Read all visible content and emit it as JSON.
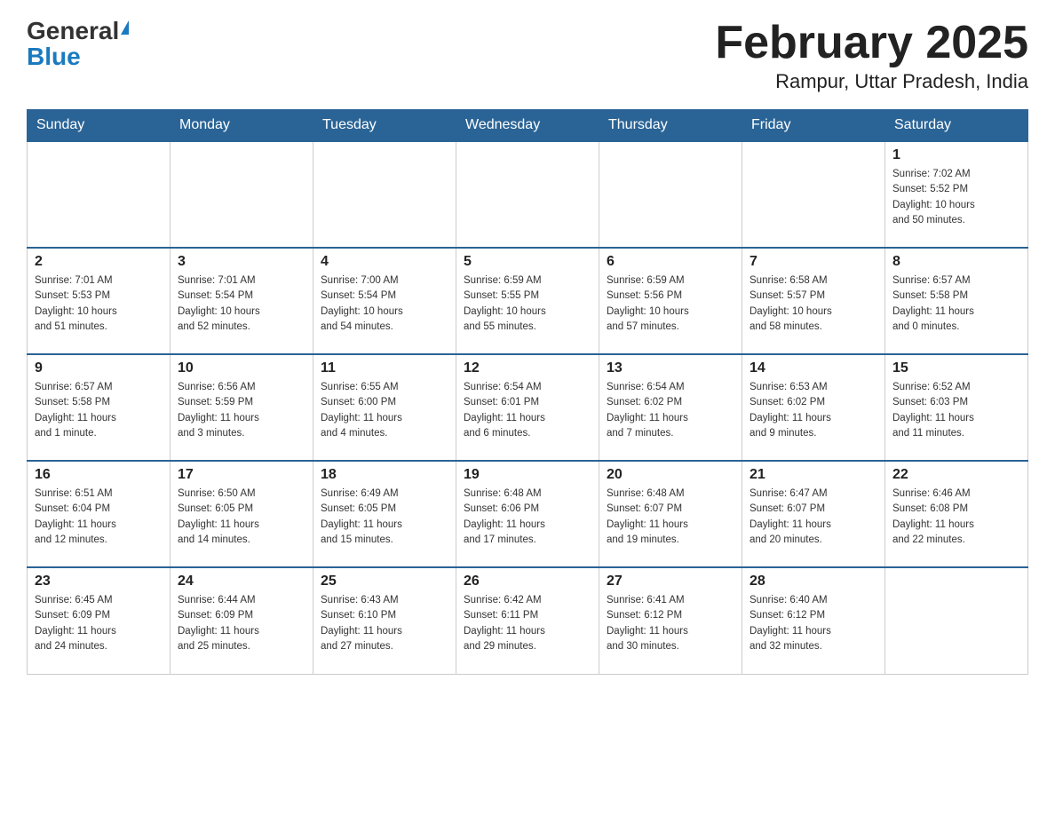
{
  "logo": {
    "general": "General",
    "blue": "Blue"
  },
  "title": "February 2025",
  "subtitle": "Rampur, Uttar Pradesh, India",
  "weekdays": [
    "Sunday",
    "Monday",
    "Tuesday",
    "Wednesday",
    "Thursday",
    "Friday",
    "Saturday"
  ],
  "weeks": [
    [
      {
        "day": "",
        "info": ""
      },
      {
        "day": "",
        "info": ""
      },
      {
        "day": "",
        "info": ""
      },
      {
        "day": "",
        "info": ""
      },
      {
        "day": "",
        "info": ""
      },
      {
        "day": "",
        "info": ""
      },
      {
        "day": "1",
        "info": "Sunrise: 7:02 AM\nSunset: 5:52 PM\nDaylight: 10 hours\nand 50 minutes."
      }
    ],
    [
      {
        "day": "2",
        "info": "Sunrise: 7:01 AM\nSunset: 5:53 PM\nDaylight: 10 hours\nand 51 minutes."
      },
      {
        "day": "3",
        "info": "Sunrise: 7:01 AM\nSunset: 5:54 PM\nDaylight: 10 hours\nand 52 minutes."
      },
      {
        "day": "4",
        "info": "Sunrise: 7:00 AM\nSunset: 5:54 PM\nDaylight: 10 hours\nand 54 minutes."
      },
      {
        "day": "5",
        "info": "Sunrise: 6:59 AM\nSunset: 5:55 PM\nDaylight: 10 hours\nand 55 minutes."
      },
      {
        "day": "6",
        "info": "Sunrise: 6:59 AM\nSunset: 5:56 PM\nDaylight: 10 hours\nand 57 minutes."
      },
      {
        "day": "7",
        "info": "Sunrise: 6:58 AM\nSunset: 5:57 PM\nDaylight: 10 hours\nand 58 minutes."
      },
      {
        "day": "8",
        "info": "Sunrise: 6:57 AM\nSunset: 5:58 PM\nDaylight: 11 hours\nand 0 minutes."
      }
    ],
    [
      {
        "day": "9",
        "info": "Sunrise: 6:57 AM\nSunset: 5:58 PM\nDaylight: 11 hours\nand 1 minute."
      },
      {
        "day": "10",
        "info": "Sunrise: 6:56 AM\nSunset: 5:59 PM\nDaylight: 11 hours\nand 3 minutes."
      },
      {
        "day": "11",
        "info": "Sunrise: 6:55 AM\nSunset: 6:00 PM\nDaylight: 11 hours\nand 4 minutes."
      },
      {
        "day": "12",
        "info": "Sunrise: 6:54 AM\nSunset: 6:01 PM\nDaylight: 11 hours\nand 6 minutes."
      },
      {
        "day": "13",
        "info": "Sunrise: 6:54 AM\nSunset: 6:02 PM\nDaylight: 11 hours\nand 7 minutes."
      },
      {
        "day": "14",
        "info": "Sunrise: 6:53 AM\nSunset: 6:02 PM\nDaylight: 11 hours\nand 9 minutes."
      },
      {
        "day": "15",
        "info": "Sunrise: 6:52 AM\nSunset: 6:03 PM\nDaylight: 11 hours\nand 11 minutes."
      }
    ],
    [
      {
        "day": "16",
        "info": "Sunrise: 6:51 AM\nSunset: 6:04 PM\nDaylight: 11 hours\nand 12 minutes."
      },
      {
        "day": "17",
        "info": "Sunrise: 6:50 AM\nSunset: 6:05 PM\nDaylight: 11 hours\nand 14 minutes."
      },
      {
        "day": "18",
        "info": "Sunrise: 6:49 AM\nSunset: 6:05 PM\nDaylight: 11 hours\nand 15 minutes."
      },
      {
        "day": "19",
        "info": "Sunrise: 6:48 AM\nSunset: 6:06 PM\nDaylight: 11 hours\nand 17 minutes."
      },
      {
        "day": "20",
        "info": "Sunrise: 6:48 AM\nSunset: 6:07 PM\nDaylight: 11 hours\nand 19 minutes."
      },
      {
        "day": "21",
        "info": "Sunrise: 6:47 AM\nSunset: 6:07 PM\nDaylight: 11 hours\nand 20 minutes."
      },
      {
        "day": "22",
        "info": "Sunrise: 6:46 AM\nSunset: 6:08 PM\nDaylight: 11 hours\nand 22 minutes."
      }
    ],
    [
      {
        "day": "23",
        "info": "Sunrise: 6:45 AM\nSunset: 6:09 PM\nDaylight: 11 hours\nand 24 minutes."
      },
      {
        "day": "24",
        "info": "Sunrise: 6:44 AM\nSunset: 6:09 PM\nDaylight: 11 hours\nand 25 minutes."
      },
      {
        "day": "25",
        "info": "Sunrise: 6:43 AM\nSunset: 6:10 PM\nDaylight: 11 hours\nand 27 minutes."
      },
      {
        "day": "26",
        "info": "Sunrise: 6:42 AM\nSunset: 6:11 PM\nDaylight: 11 hours\nand 29 minutes."
      },
      {
        "day": "27",
        "info": "Sunrise: 6:41 AM\nSunset: 6:12 PM\nDaylight: 11 hours\nand 30 minutes."
      },
      {
        "day": "28",
        "info": "Sunrise: 6:40 AM\nSunset: 6:12 PM\nDaylight: 11 hours\nand 32 minutes."
      },
      {
        "day": "",
        "info": ""
      }
    ]
  ]
}
